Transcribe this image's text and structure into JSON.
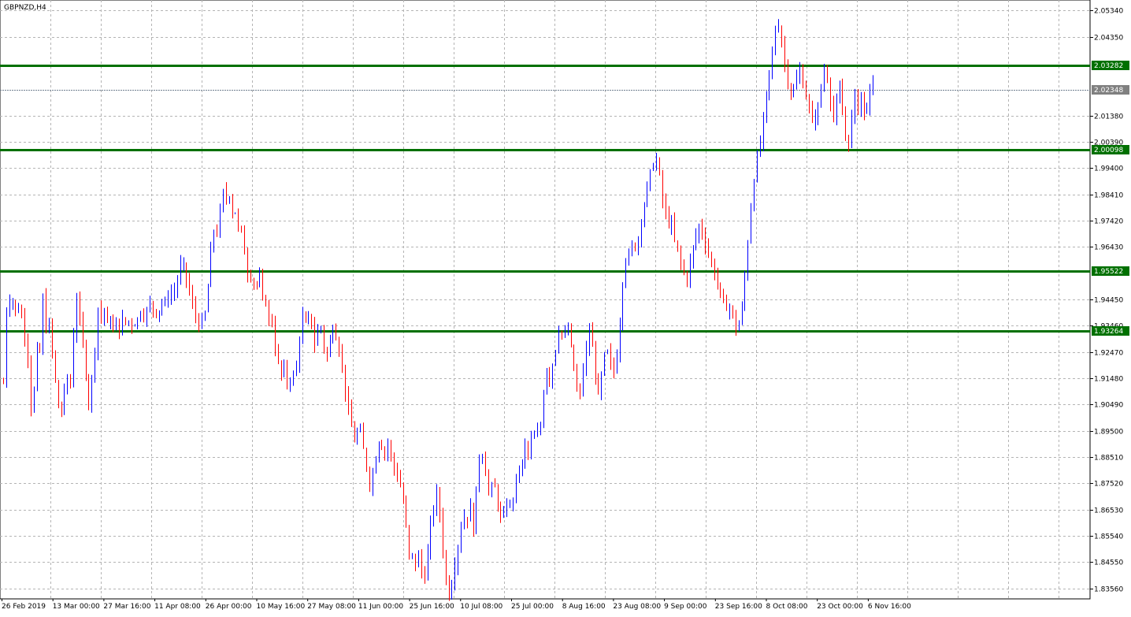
{
  "chart_data": {
    "type": "candlestick",
    "symbol_label": "GBPNZD,H4",
    "x_tick_labels": [
      "26 Feb 2019",
      "13 Mar 00:00",
      "27 Mar 16:00",
      "11 Apr 08:00",
      "26 Apr 00:00",
      "10 May 16:00",
      "27 May 08:00",
      "11 Jun 00:00",
      "25 Jun 16:00",
      "10 Jul 08:00",
      "25 Jul 00:00",
      "8 Aug 16:00",
      "23 Aug 08:00",
      "9 Sep 00:00",
      "23 Sep 16:00",
      "8 Oct 08:00",
      "23 Oct 00:00",
      "6 Nov 16:00"
    ],
    "y_tick_labels": [
      "2.05340",
      "2.04350",
      "2.01380",
      "2.00390",
      "1.99400",
      "1.98410",
      "1.97420",
      "1.96430",
      "1.94450",
      "1.93460",
      "1.92470",
      "1.91480",
      "1.90490",
      "1.89500",
      "1.88510",
      "1.87520",
      "1.86530",
      "1.85540",
      "1.84550",
      "1.83560"
    ],
    "ylim": [
      1.8316,
      2.0574
    ],
    "grid": true,
    "colors": {
      "up": "#0000ff",
      "down": "#ff0000",
      "grid": "#b4b4b4",
      "level_line": "#007000",
      "level_label_bg": "#007000",
      "current_price_label_bg": "#808080",
      "current_price_line": "#708090"
    },
    "levels": [
      {
        "label": "2.03282",
        "value": 2.03282
      },
      {
        "label": "2.00098",
        "value": 2.00098
      },
      {
        "label": "1.95522",
        "value": 1.95522
      },
      {
        "label": "1.93264",
        "value": 1.93264
      }
    ],
    "current_price": {
      "label": "2.02348",
      "value": 2.02348
    },
    "price_path": [
      [
        1.913,
        1.926,
        1.948,
        1.941,
        1.952,
        1.945,
        1.932,
        1.942,
        1.946,
        1.936,
        1.938,
        1.935,
        1.931,
        1.928,
        1.918,
        1.904,
        1.901,
        1.912,
        1.926,
        1.924,
        1.921,
        1.941,
        1.945,
        1.938,
        1.931,
        1.936,
        1.929,
        1.924,
        1.915,
        1.912,
        1.906,
        1.898,
        1.903,
        1.906,
        1.912,
        1.918,
        1.908,
        1.912
      ],
      [
        1.912,
        1.922,
        1.938,
        1.946,
        1.943,
        1.935,
        1.931,
        1.924,
        1.918,
        1.912,
        1.905,
        1.911,
        1.918,
        1.926,
        1.937,
        1.943,
        1.939,
        1.935,
        1.941,
        1.936,
        1.933,
        1.938,
        1.935,
        1.932,
        1.937,
        1.935,
        1.932,
        1.938,
        1.936,
        1.933,
        1.939,
        1.937,
        1.931,
        1.937,
        1.935,
        1.938,
        1.937
      ],
      [
        1.937,
        1.941,
        1.938,
        1.943,
        1.941,
        1.939,
        1.944,
        1.942,
        1.948,
        1.946,
        1.952,
        1.958,
        1.955,
        1.948,
        1.941,
        1.937,
        1.934,
        1.939
      ],
      [
        1.939,
        1.946,
        1.951,
        1.961,
        1.967,
        1.971,
        1.968,
        1.972,
        1.976,
        1.981,
        1.985,
        1.983,
        1.982,
        1.985,
        1.98,
        1.977,
        1.979,
        1.976,
        1.971,
        1.972,
        1.968,
        1.964,
        1.959,
        1.955,
        1.951,
        1.956,
        1.952,
        1.948,
        1.951,
        1.954,
        1.949,
        1.944,
        1.941,
        1.945,
        1.938,
        1.935,
        1.936
      ],
      [
        1.936,
        1.93,
        1.925,
        1.921,
        1.918,
        1.916,
        1.915,
        1.919,
        1.914,
        1.912,
        1.915,
        1.918,
        1.914,
        1.916,
        1.924,
        1.93,
        1.935,
        1.938,
        1.936,
        1.933,
        1.937,
        1.939,
        1.935,
        1.93,
        1.926,
        1.932,
        1.936,
        1.934,
        1.929,
        1.925,
        1.922,
        1.925,
        1.929,
        1.934,
        1.936,
        1.932,
        1.93,
        1.926
      ],
      [
        1.926,
        1.921,
        1.916,
        1.908,
        1.902,
        1.898,
        1.894,
        1.891,
        1.894,
        1.896,
        1.892,
        1.887,
        1.883,
        1.878,
        1.874,
        1.879,
        1.884,
        1.889,
        1.893,
        1.89,
        1.886,
        1.888,
        1.891,
        1.886,
        1.882,
        1.88,
        1.878,
        1.875,
        1.872,
        1.866,
        1.858
      ],
      [
        1.858,
        1.85,
        1.845,
        1.848,
        1.846,
        1.844,
        1.849,
        1.846,
        1.841,
        1.838,
        1.843,
        1.848,
        1.854,
        1.86,
        1.866,
        1.869,
        1.871,
        1.867,
        1.86,
        1.851,
        1.842,
        1.837,
        1.833,
        1.836,
        1.839,
        1.844,
        1.848,
        1.852,
        1.856,
        1.861,
        1.864,
        1.859,
        1.863,
        1.867,
        1.864,
        1.858
      ],
      [
        1.858,
        1.869,
        1.882,
        1.889,
        1.886,
        1.879,
        1.873,
        1.871,
        1.876,
        1.871,
        1.867,
        1.862,
        1.86,
        1.866,
        1.871,
        1.865,
        1.87,
        1.876,
        1.881,
        1.878,
        1.885,
        1.89,
        1.886,
        1.892,
        1.889,
        1.895,
        1.893,
        1.897
      ],
      [
        1.897,
        1.904,
        1.913,
        1.92,
        1.918,
        1.914,
        1.917,
        1.921,
        1.924,
        1.928,
        1.933,
        1.936,
        1.931,
        1.935,
        1.929,
        1.932,
        1.935,
        1.927,
        1.922,
        1.918,
        1.912,
        1.909,
        1.906,
        1.912,
        1.918,
        1.922,
        1.925,
        1.931,
        1.934,
        1.928,
        1.922,
        1.918,
        1.911,
        1.906,
        1.912,
        1.918,
        1.921,
        1.927,
        1.924
      ],
      [
        1.924,
        1.921,
        1.915,
        1.919,
        1.926,
        1.935,
        1.949,
        1.958,
        1.962,
        1.96,
        1.964,
        1.967,
        1.962,
        1.97,
        1.976,
        1.979,
        1.984,
        1.989,
        1.992,
        1.996,
        1.999,
        1.994,
        1.988,
        1.981,
        1.977,
        1.972,
        1.976,
        1.971,
        1.966
      ],
      [
        1.966,
        1.963,
        1.959,
        1.955,
        1.951,
        1.956,
        1.961,
        1.966,
        1.97,
        1.973,
        1.969,
        1.966,
        1.962,
        1.958,
        1.955,
        1.952,
        1.948,
        1.943,
        1.94,
        1.944,
        1.941,
        1.936,
        1.933,
        1.936,
        1.941
      ],
      [
        1.941,
        1.952,
        1.966,
        1.978,
        1.99,
        1.996,
        2.002,
        2.009,
        2.017,
        2.028,
        2.033,
        2.041,
        2.052,
        2.046,
        2.038,
        2.031,
        2.026,
        2.021,
        2.024,
        2.028,
        2.031,
        2.026,
        2.021,
        2.017
      ],
      [
        2.017,
        2.013,
        2.009,
        2.012,
        2.016,
        2.014,
        2.019,
        2.024,
        2.028,
        2.031,
        2.026,
        2.029,
        2.024,
        2.019,
        2.015,
        2.012,
        2.016,
        2.02,
        2.024,
        2.019,
        2.014,
        2.01,
        2.006,
        2.002,
        2.005,
        2.01,
        2.016,
        2.022,
        2.019,
        2.016,
        2.019,
        2.023,
        2.018,
        2.013,
        2.016,
        2.02,
        2.024,
        2.02,
        2.025,
        2.028,
        2.023
      ]
    ]
  }
}
